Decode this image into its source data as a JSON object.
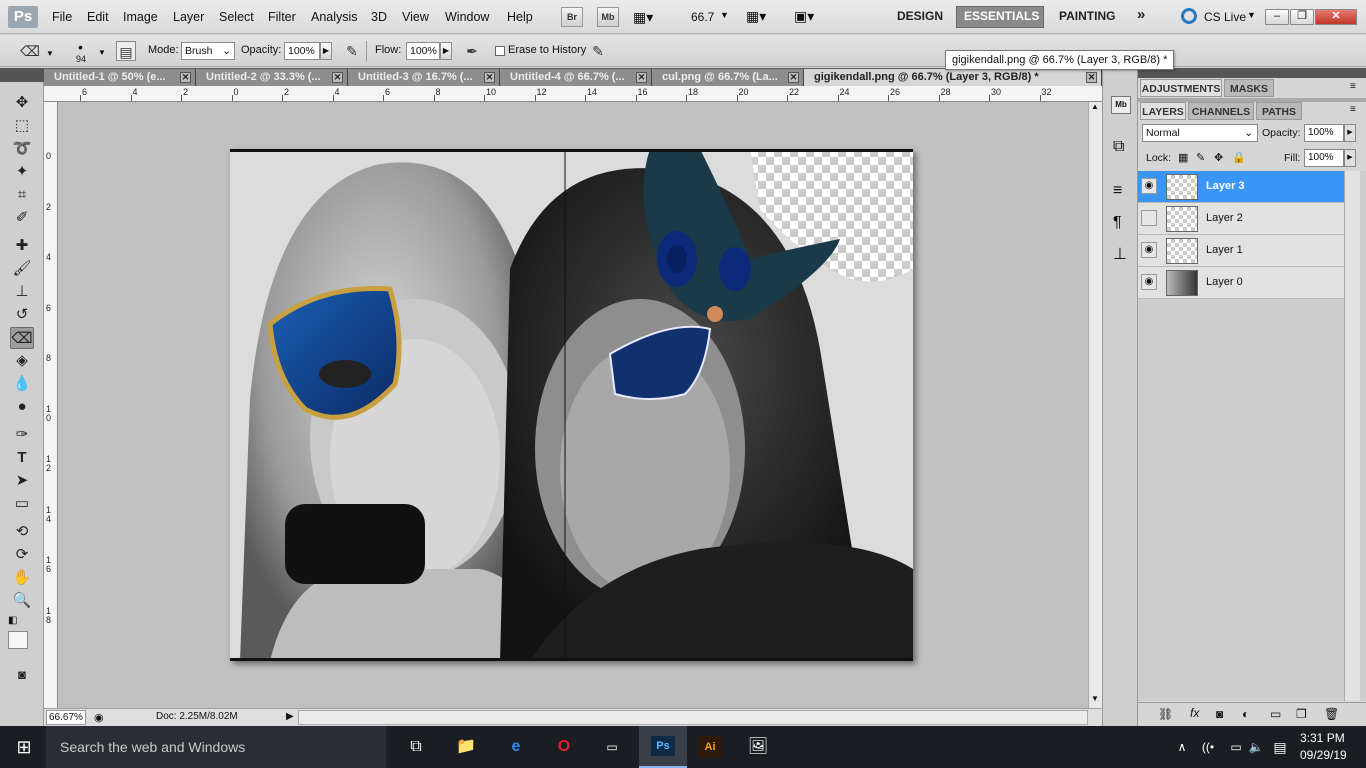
{
  "menubar": {
    "app_logo": "Ps",
    "items": [
      "File",
      "Edit",
      "Image",
      "Layer",
      "Select",
      "Filter",
      "Analysis",
      "3D",
      "View",
      "Window",
      "Help"
    ],
    "bridge_label": "Br",
    "minibridge_label": "Mb",
    "zoom": "66.7",
    "workspaces": [
      "DESIGN",
      "ESSENTIALS",
      "PAINTING"
    ],
    "more_label": "»",
    "cs_live": "CS Live"
  },
  "options": {
    "brush_size": "94",
    "mode_label": "Mode:",
    "mode_value": "Brush",
    "opacity_label": "Opacity:",
    "opacity_value": "100%",
    "flow_label": "Flow:",
    "flow_value": "100%",
    "erase_history_label": "Erase to History"
  },
  "tooltip": "gigikendall.png @ 66.7% (Layer 3, RGB/8) *",
  "tabs": [
    {
      "label": "Untitled-1 @ 50% (e..."
    },
    {
      "label": "Untitled-2 @ 33.3% (..."
    },
    {
      "label": "Untitled-3 @ 16.7% (..."
    },
    {
      "label": "Untitled-4 @ 66.7% (..."
    },
    {
      "label": "cul.png @ 66.7% (La..."
    },
    {
      "label": "gigikendall.png @ 66.7% (Layer 3, RGB/8) *"
    }
  ],
  "ruler_top": [
    "6",
    "4",
    "2",
    "0",
    "2",
    "4",
    "6",
    "8",
    "10",
    "12",
    "14",
    "16",
    "18",
    "20",
    "22",
    "24",
    "26",
    "28",
    "30",
    "32"
  ],
  "ruler_left": [
    "0",
    "2",
    "4",
    "6",
    "8",
    "1\n0",
    "1\n2",
    "1\n4",
    "1\n6",
    "1\n8"
  ],
  "status": {
    "zoom": "66.67%",
    "doc": "Doc: 2.25M/8.02M"
  },
  "panels": {
    "top_tabs": [
      "ADJUSTMENTS",
      "MASKS"
    ],
    "layer_tabs": [
      "LAYERS",
      "CHANNELS",
      "PATHS"
    ],
    "blend_mode": "Normal",
    "opacity_label": "Opacity:",
    "opacity_value": "100%",
    "lock_label": "Lock:",
    "fill_label": "Fill:",
    "fill_value": "100%",
    "layers": [
      {
        "name": "Layer 3",
        "visible": true,
        "selected": true
      },
      {
        "name": "Layer 2",
        "visible": false,
        "selected": false
      },
      {
        "name": "Layer 1",
        "visible": true,
        "selected": false
      },
      {
        "name": "Layer 0",
        "visible": true,
        "selected": false
      }
    ]
  },
  "taskbar": {
    "search_placeholder": "Search the web and Windows",
    "ai_label": "Ai",
    "ps_label": "Ps",
    "time": "3:31 PM",
    "date": "09/29/19"
  }
}
